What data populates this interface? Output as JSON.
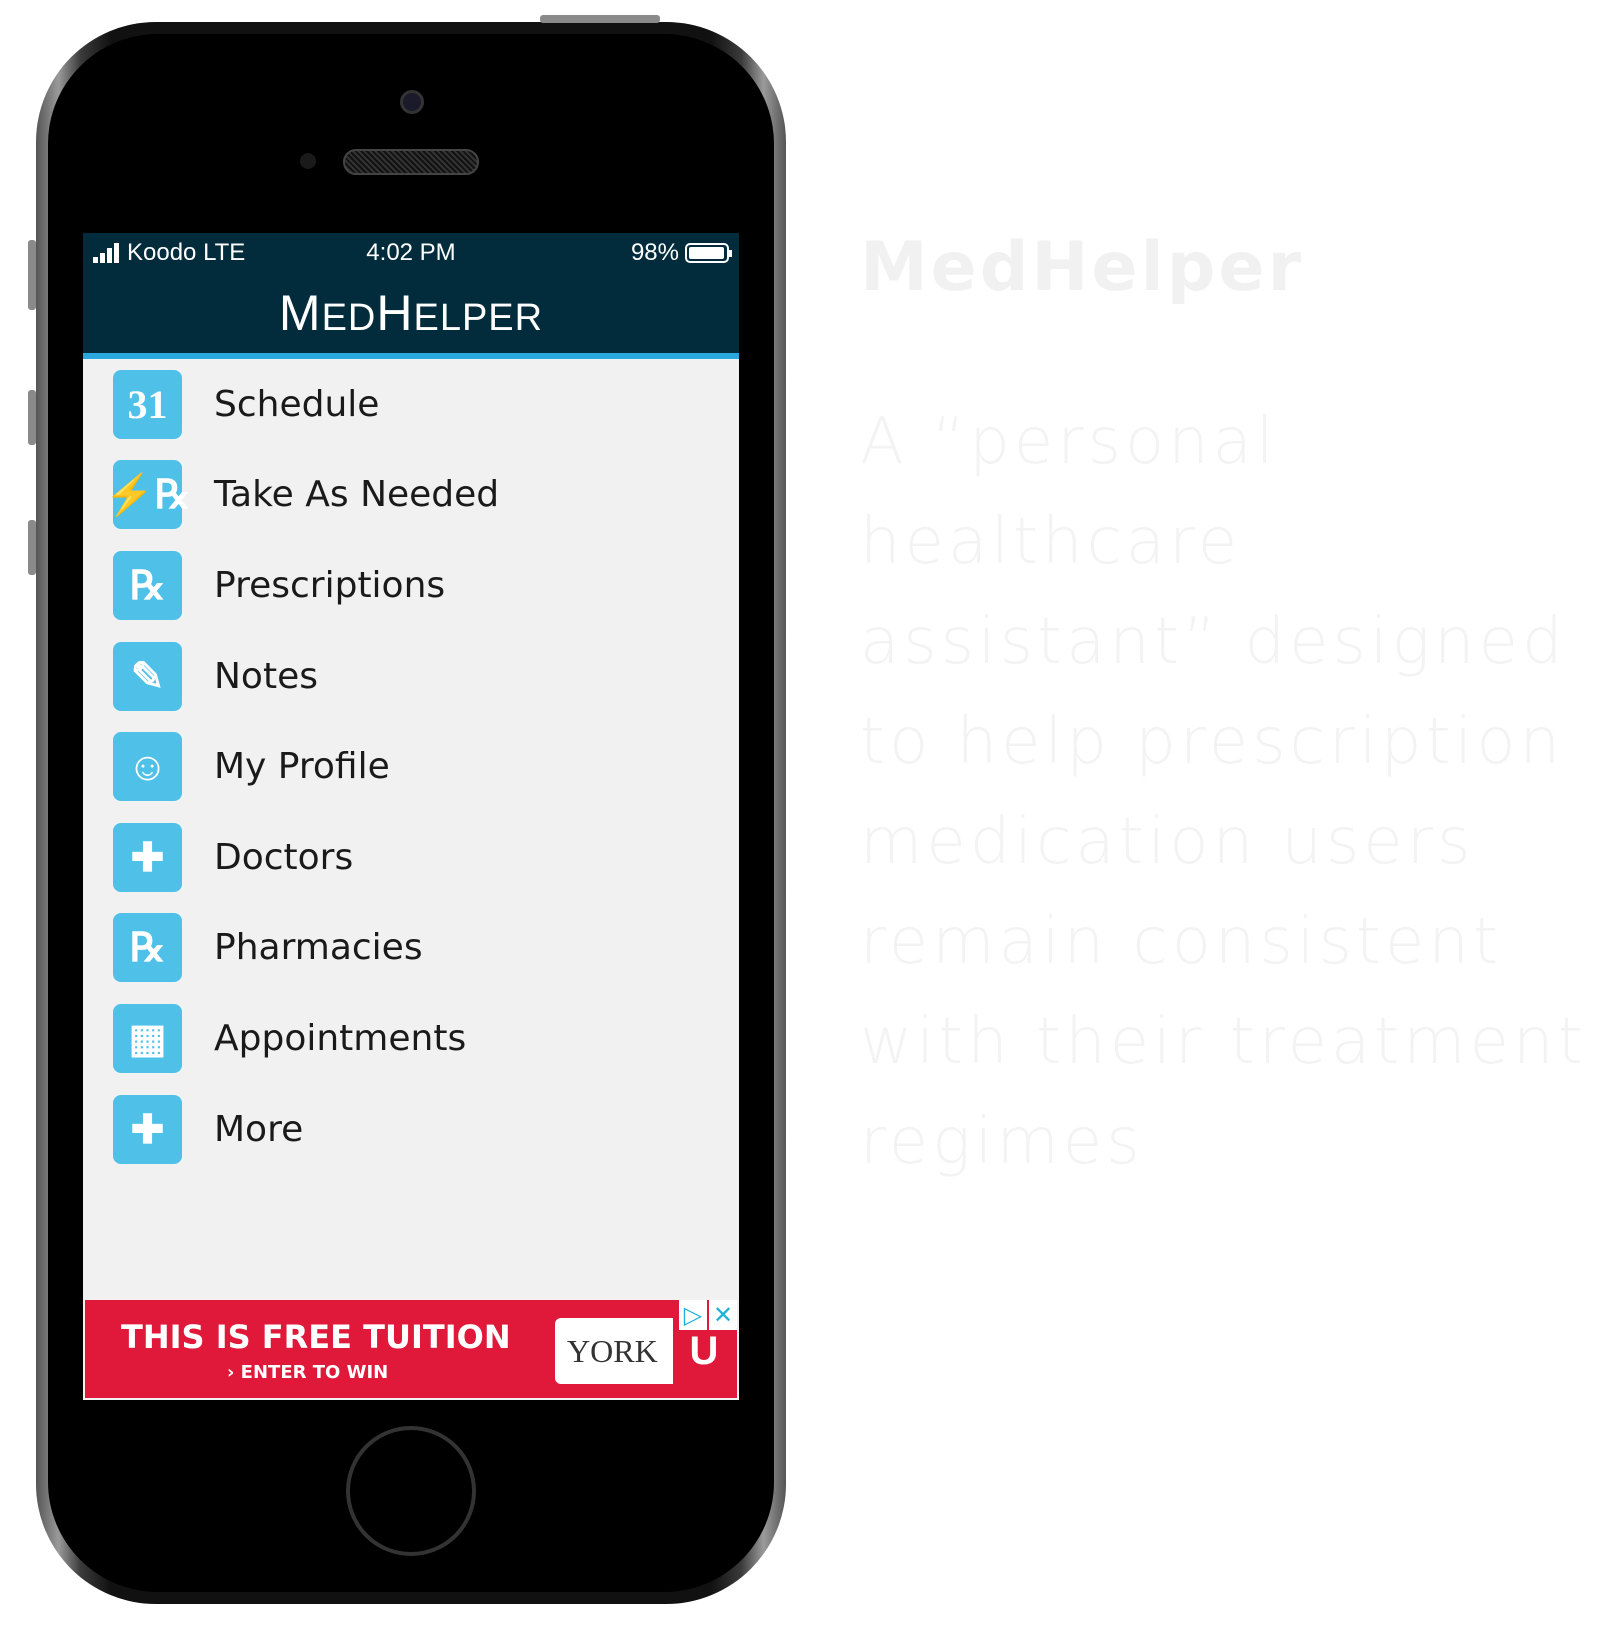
{
  "status_bar": {
    "carrier": "Koodo LTE",
    "time": "4:02 PM",
    "battery": "98%",
    "battery_level": 0.98
  },
  "app": {
    "title_big1": "M",
    "title_small1": "ED",
    "title_big2": "H",
    "title_small2": "ELPER"
  },
  "menu": [
    {
      "label": "Schedule",
      "icon": "calendar-31-icon",
      "glyph": "31"
    },
    {
      "label": "Take As Needed",
      "icon": "rx-lightning-icon",
      "glyph": "⚡℞"
    },
    {
      "label": "Prescriptions",
      "icon": "rx-icon",
      "glyph": "℞"
    },
    {
      "label": "Notes",
      "icon": "notepad-pencil-icon",
      "glyph": "✎"
    },
    {
      "label": "My Profile",
      "icon": "profile-icon",
      "glyph": "☺"
    },
    {
      "label": "Doctors",
      "icon": "medical-kit-icon",
      "glyph": "✚"
    },
    {
      "label": "Pharmacies",
      "icon": "pharmacy-house-icon",
      "glyph": "℞"
    },
    {
      "label": "Appointments",
      "icon": "calendar-grid-icon",
      "glyph": "▦"
    },
    {
      "label": "More",
      "icon": "plus-icon",
      "glyph": "✚"
    }
  ],
  "ad": {
    "headline": "THIS IS FREE TUITION",
    "subline": "› ENTER TO WIN",
    "logo_text": "YORK",
    "logo_letter": "U",
    "adchoices": "▷",
    "close": "✕"
  },
  "side": {
    "title": "MedHelper",
    "description": "A “personal healthcare assistant” designed to help prescription medication users remain consistent with their treatment regimes"
  }
}
